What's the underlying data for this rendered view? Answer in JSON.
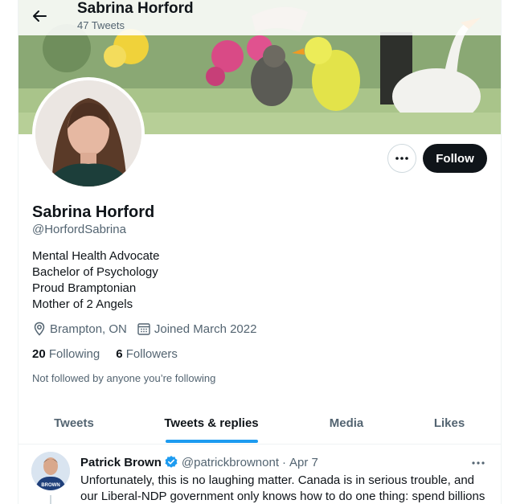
{
  "header": {
    "display_name": "Sabrina Horford",
    "tweet_count": "47 Tweets"
  },
  "profile": {
    "display_name": "Sabrina Horford",
    "handle": "@HorfordSabrina",
    "bio": [
      "Mental Health Advocate",
      "Bachelor of Psychology",
      "Proud Bramptonian",
      "Mother of 2 Angels"
    ],
    "location": "Brampton, ON",
    "joined": "Joined March 2022",
    "following_count": "20",
    "following_label": "Following",
    "followers_count": "6",
    "followers_label": "Followers",
    "not_followed_note": "Not followed by anyone you’re following",
    "follow_label": "Follow"
  },
  "tabs": [
    {
      "label": "Tweets"
    },
    {
      "label": "Tweets & replies"
    },
    {
      "label": "Media"
    },
    {
      "label": "Likes"
    }
  ],
  "tweet": {
    "author": "Patrick Brown",
    "handle": "@patrickbrownont",
    "separator": "·",
    "date": "Apr 7",
    "avatar_text": "BROWN",
    "body": "Unfortunately, this is no laughing matter. Canada is in serious trouble, and our Liberal-NDP government only knows how to do one thing: spend billions"
  },
  "colors": {
    "accent": "#1d9bf0",
    "text_primary": "#0f1419",
    "text_secondary": "#536471",
    "follow_bg": "#0f1419"
  }
}
